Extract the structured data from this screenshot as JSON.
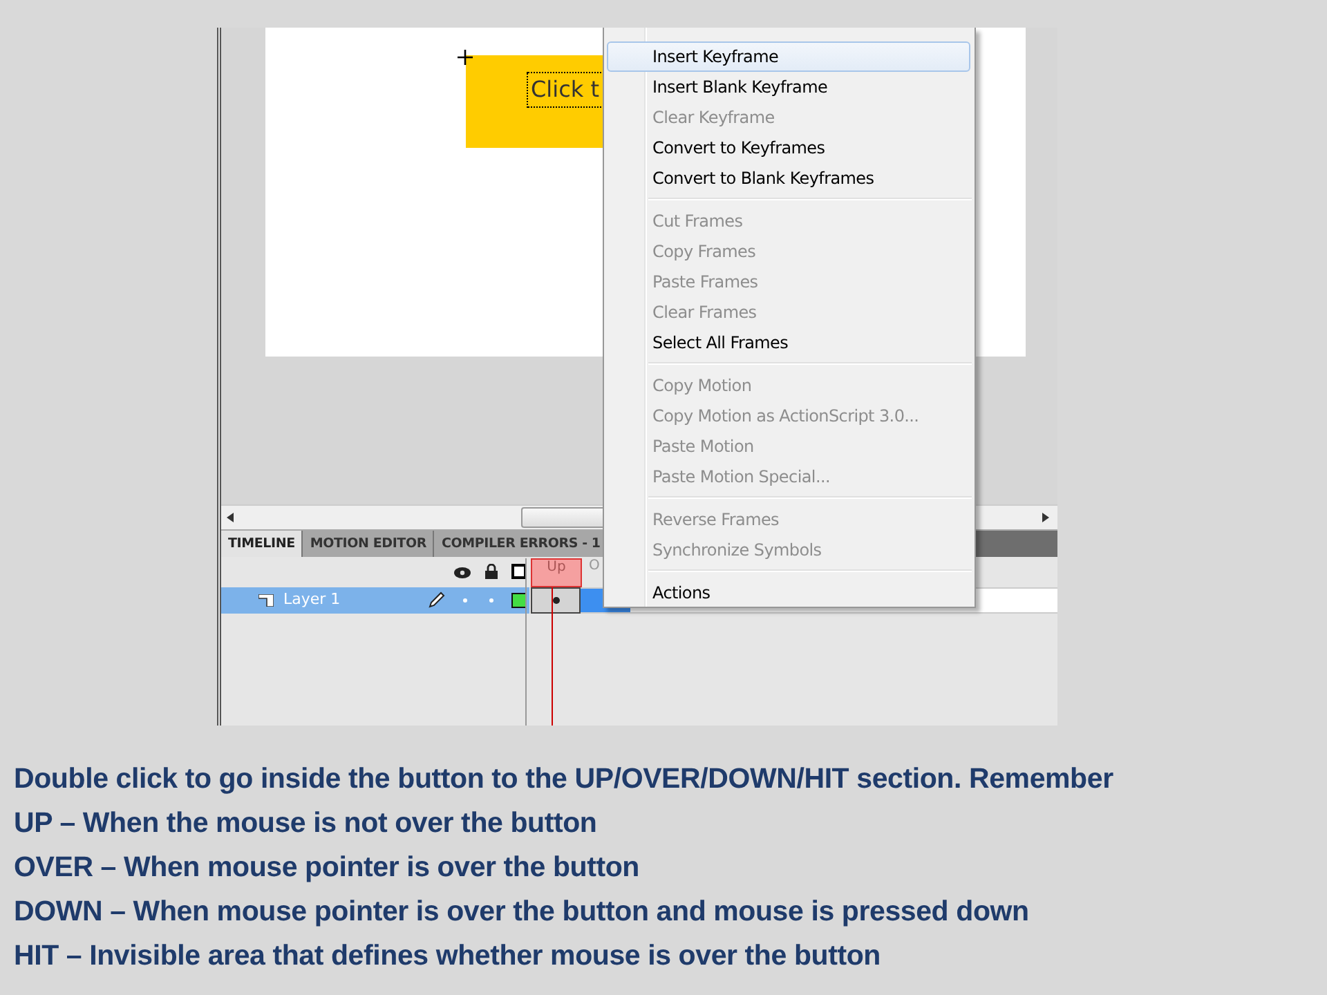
{
  "stage": {
    "button_label": "Click t"
  },
  "tabs": [
    {
      "label": "TIMELINE",
      "selected": true
    },
    {
      "label": "MOTION EDITOR",
      "selected": false
    },
    {
      "label": "COMPILER ERRORS - 1",
      "selected": false
    }
  ],
  "frame_labels": [
    {
      "label": "Up",
      "selected": true
    },
    {
      "label": "O",
      "selected": false
    }
  ],
  "layers": [
    {
      "name": "Layer 1",
      "selected": true
    }
  ],
  "context_menu": {
    "groups": [
      {
        "items": [
          {
            "label": "Insert Keyframe",
            "disabled": false,
            "highlighted": true
          },
          {
            "label": "Insert Blank Keyframe",
            "disabled": false,
            "highlighted": false
          },
          {
            "label": "Clear Keyframe",
            "disabled": true,
            "highlighted": false
          },
          {
            "label": "Convert to Keyframes",
            "disabled": false,
            "highlighted": false
          },
          {
            "label": "Convert to Blank Keyframes",
            "disabled": false,
            "highlighted": false
          }
        ]
      },
      {
        "items": [
          {
            "label": "Cut Frames",
            "disabled": true,
            "highlighted": false
          },
          {
            "label": "Copy Frames",
            "disabled": true,
            "highlighted": false
          },
          {
            "label": "Paste Frames",
            "disabled": true,
            "highlighted": false
          },
          {
            "label": "Clear Frames",
            "disabled": true,
            "highlighted": false
          },
          {
            "label": "Select All Frames",
            "disabled": false,
            "highlighted": false
          }
        ]
      },
      {
        "items": [
          {
            "label": "Copy Motion",
            "disabled": true,
            "highlighted": false
          },
          {
            "label": "Copy Motion as ActionScript 3.0...",
            "disabled": true,
            "highlighted": false
          },
          {
            "label": "Paste Motion",
            "disabled": true,
            "highlighted": false
          },
          {
            "label": "Paste Motion Special...",
            "disabled": true,
            "highlighted": false
          }
        ]
      },
      {
        "items": [
          {
            "label": "Reverse Frames",
            "disabled": true,
            "highlighted": false
          },
          {
            "label": "Synchronize Symbols",
            "disabled": true,
            "highlighted": false
          }
        ]
      },
      {
        "items": [
          {
            "label": "Actions",
            "disabled": false,
            "highlighted": false
          }
        ]
      }
    ]
  },
  "caption": [
    "Double click to go inside the button to the UP/OVER/DOWN/HIT section. Remember",
    "UP – When the mouse is not over the button",
    "OVER – When mouse pointer is over the button",
    "DOWN – When mouse pointer is over the button and mouse is pressed down",
    "HIT – Invisible area that defines whether mouse is over the button"
  ]
}
